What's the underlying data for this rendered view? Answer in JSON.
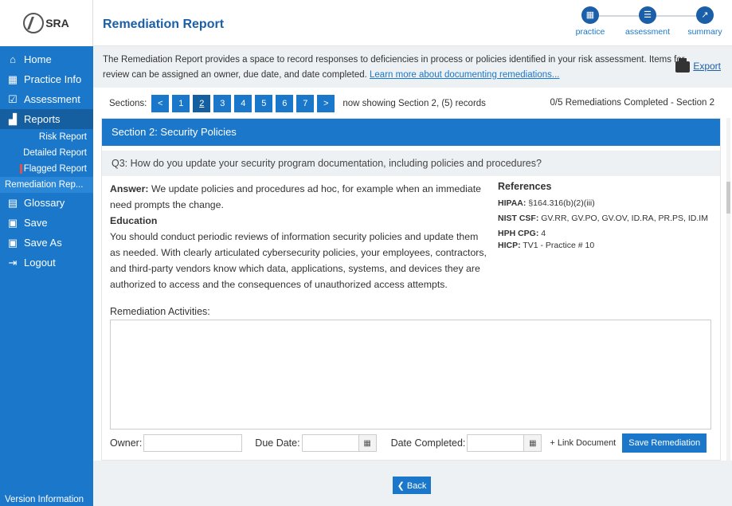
{
  "logo": {
    "text": "SRA"
  },
  "sidebar": {
    "items": [
      {
        "label": "Home",
        "icon": "home-icon"
      },
      {
        "label": "Practice Info",
        "icon": "building-icon"
      },
      {
        "label": "Assessment",
        "icon": "checklist-icon"
      },
      {
        "label": "Reports",
        "icon": "chart-icon"
      }
    ],
    "sub_items": [
      {
        "label": "Risk Report"
      },
      {
        "label": "Detailed Report"
      },
      {
        "label": "Flagged Report"
      },
      {
        "label": "Remediation Rep..."
      }
    ],
    "items2": [
      {
        "label": "Glossary",
        "icon": "book-icon"
      },
      {
        "label": "Save",
        "icon": "save-icon"
      },
      {
        "label": "Save As",
        "icon": "save-as-icon"
      },
      {
        "label": "Logout",
        "icon": "logout-icon"
      }
    ],
    "version": "Version Information"
  },
  "header": {
    "title": "Remediation Report",
    "steps": [
      {
        "label": "practice",
        "icon": "practice-step-icon"
      },
      {
        "label": "assessment",
        "icon": "assessment-step-icon"
      },
      {
        "label": "summary",
        "icon": "summary-step-icon"
      }
    ]
  },
  "intro": {
    "text1": "The Remediation Report provides a space to record responses to deficiencies in process or policies identified in your risk assessment. Items for",
    "text2": "review can be assigned an owner, due date, and date completed. ",
    "link": "Learn more about documenting remediations...",
    "export_label": "Export"
  },
  "sections_bar": {
    "label": "Sections:",
    "prev": "<",
    "next": ">",
    "sections": [
      "1",
      "2",
      "3",
      "4",
      "5",
      "6",
      "7"
    ],
    "active_section": "2",
    "showing": "now showing Section 2, (5) records",
    "completed": "0/5 Remediations Completed - Section 2"
  },
  "section": {
    "title": "Section 2: Security Policies",
    "question": "Q3: How do you update your security program documentation, including policies and procedures?",
    "answer_label": "Answer:",
    "answer": "We update policies and procedures ad hoc, for example when an immediate need prompts the change.",
    "education_label": "Education",
    "education": "You should conduct periodic reviews of information security policies and update them as needed. With clearly articulated cybersecurity policies, your employees, contractors, and third-party vendors know which data, applications, systems, and devices they are authorized to access and the consequences of unauthorized access attempts.",
    "references_title": "References",
    "references": [
      {
        "label": "HIPAA:",
        "value": "§164.316(b)(2)(iii)"
      },
      {
        "label": "NIST CSF:",
        "value": "GV.RR, GV.PO, GV.OV, ID.RA, PR.PS, ID.IM"
      },
      {
        "label": "HPH CPG:",
        "value": "4"
      },
      {
        "label": "HICP:",
        "value": "TV1 - Practice # 10"
      }
    ]
  },
  "remediation": {
    "label": "Remediation Activities:",
    "text": "",
    "owner_label": "Owner:",
    "owner_value": "",
    "due_label": "Due Date:",
    "due_value": "",
    "completed_label": "Date Completed:",
    "completed_value": "",
    "link_document": "+ Link Document",
    "save": "Save Remediation"
  },
  "footer": {
    "back": "❮ Back"
  },
  "colors": {
    "primary": "#1a77c9",
    "dark": "#155fa0",
    "header_title": "#1a5fa8"
  }
}
